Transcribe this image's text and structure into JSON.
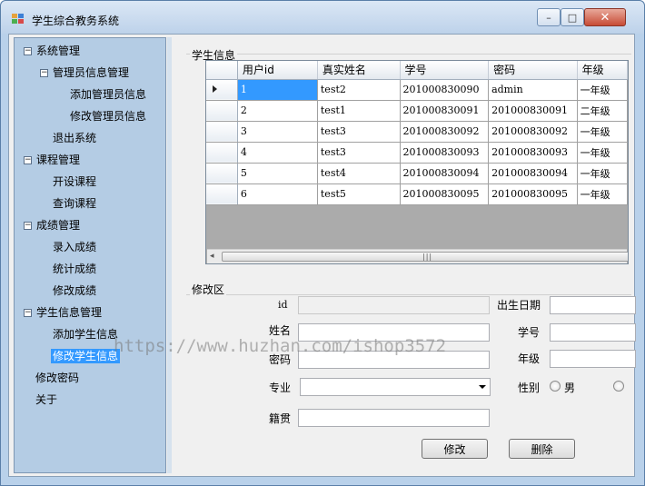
{
  "window": {
    "title": "学生综合教务系统",
    "controls": {
      "minimize": "–",
      "maximize": "□",
      "close": "✕"
    }
  },
  "tree": [
    {
      "label": "系统管理",
      "toggle": "−"
    },
    {
      "label": "管理员信息管理",
      "toggle": "−"
    },
    {
      "label": "添加管理员信息"
    },
    {
      "label": "修改管理员信息"
    },
    {
      "label": "退出系统"
    },
    {
      "label": "课程管理",
      "toggle": "−"
    },
    {
      "label": "开设课程"
    },
    {
      "label": "查询课程"
    },
    {
      "label": "成绩管理",
      "toggle": "−"
    },
    {
      "label": "录入成绩"
    },
    {
      "label": "统计成绩"
    },
    {
      "label": "修改成绩"
    },
    {
      "label": "学生信息管理",
      "toggle": "−"
    },
    {
      "label": "添加学生信息"
    },
    {
      "label": "修改学生信息"
    },
    {
      "label": "修改密码"
    },
    {
      "label": "关于"
    }
  ],
  "student_info": {
    "group_title": "学生信息",
    "columns": [
      "用户id",
      "真实姓名",
      "学号",
      "密码",
      "年级"
    ],
    "rows": [
      [
        "1",
        "test2",
        "201000830090",
        "admin",
        "一年级"
      ],
      [
        "2",
        "test1",
        "201000830091",
        "201000830091",
        "二年级"
      ],
      [
        "3",
        "test3",
        "201000830092",
        "201000830092",
        "一年级"
      ],
      [
        "4",
        "test3",
        "201000830093",
        "201000830093",
        "一年级"
      ],
      [
        "5",
        "test4",
        "201000830094",
        "201000830094",
        "一年级"
      ],
      [
        "6",
        "test5",
        "201000830095",
        "201000830095",
        "一年级"
      ]
    ],
    "scroll_grip": "|||"
  },
  "edit_area": {
    "group_title": "修改区",
    "id_label": "id",
    "name_label": "姓名",
    "password_label": "密码",
    "major_label": "专业",
    "hometown_label": "籍贯",
    "birthdate_label": "出生日期",
    "student_no_label": "学号",
    "grade_label": "年级",
    "gender_label": "性别",
    "gender_male": "男",
    "modify_button": "修改",
    "delete_button": "删除"
  },
  "watermark": "https://www.huzhan.com/ishop3572"
}
